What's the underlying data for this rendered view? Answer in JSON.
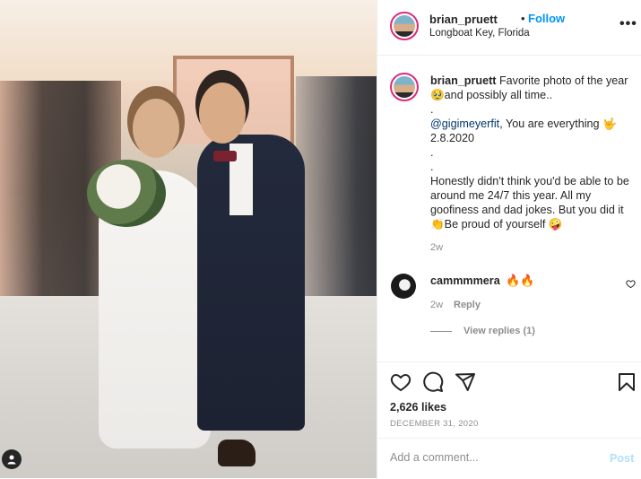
{
  "post": {
    "username": "brian_pruett",
    "follow_separator": "•",
    "follow_label": "Follow",
    "location": "Longboat Key, Florida",
    "more_label": "•••"
  },
  "caption": {
    "username": "brian_pruett",
    "line1": "Favorite photo of the year 🥹and possibly all time..",
    "dot1": ".",
    "mention": "@gigimeyerfit",
    "line2": ", You are everything 🤟",
    "date_line": "2.8.2020",
    "dot2": ".",
    "dot3": ".",
    "line3": "Honestly didn't think you'd be able to be around me 24/7 this year. All my goofiness and dad jokes. But you did it 👏Be proud of yourself 🤪",
    "time": "2w"
  },
  "comment": {
    "username": "cammmmera",
    "text": "🔥🔥",
    "time": "2w",
    "reply_label": "Reply",
    "view_replies": "View replies (1)"
  },
  "actions": {
    "likes": "2,626 likes",
    "date": "DECEMBER 31, 2020",
    "icons": [
      "heart-icon",
      "comment-icon",
      "share-icon",
      "bookmark-icon"
    ]
  },
  "add_comment": {
    "placeholder": "Add a comment...",
    "post_label": "Post"
  },
  "colors": {
    "accent": "#0095f6",
    "post_disabled": "#b2dffc",
    "muted": "#8e8e8e",
    "text": "#262626"
  }
}
